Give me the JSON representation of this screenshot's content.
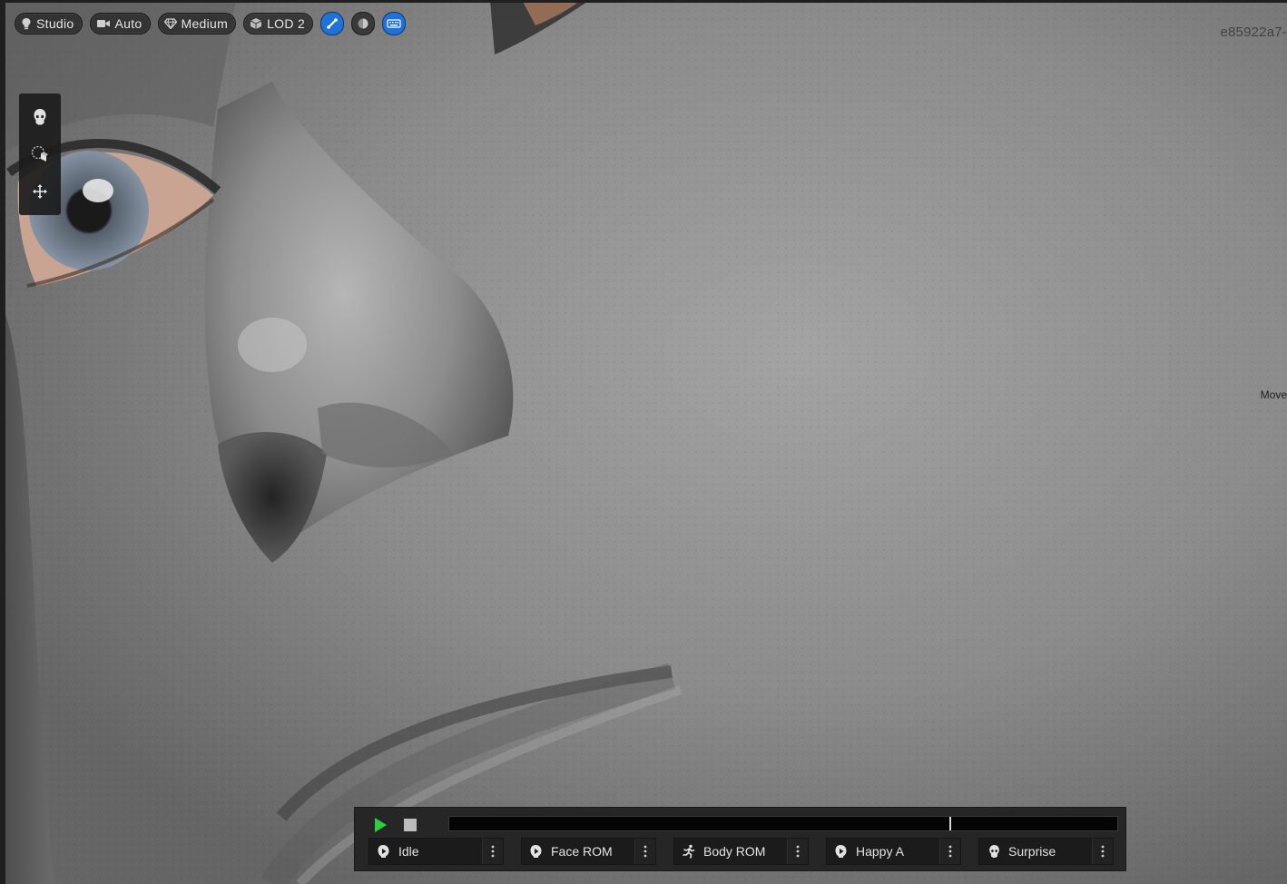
{
  "viewport": {
    "toolbar": {
      "lighting_label": "Studio",
      "camera_label": "Auto",
      "quality_label": "Medium",
      "lod_label": "LOD 2"
    },
    "guid_text": "e85922a7-",
    "side_label": "Move",
    "left_tools": [
      "head-icon",
      "cube-select-icon",
      "move-icon"
    ]
  },
  "animation_bar": {
    "playhead_fraction": 0.75,
    "buttons": [
      {
        "label": "Idle",
        "icon": "face-play-icon"
      },
      {
        "label": "Face ROM",
        "icon": "face-play-icon"
      },
      {
        "label": "Body ROM",
        "icon": "running-figure-icon"
      },
      {
        "label": "Happy A",
        "icon": "face-play-icon"
      },
      {
        "label": "Surprise",
        "icon": "head-icon"
      }
    ]
  },
  "colors": {
    "accent_blue": "#1f73d8",
    "play_green": "#2ecc40",
    "panel_dark": "#262626"
  }
}
